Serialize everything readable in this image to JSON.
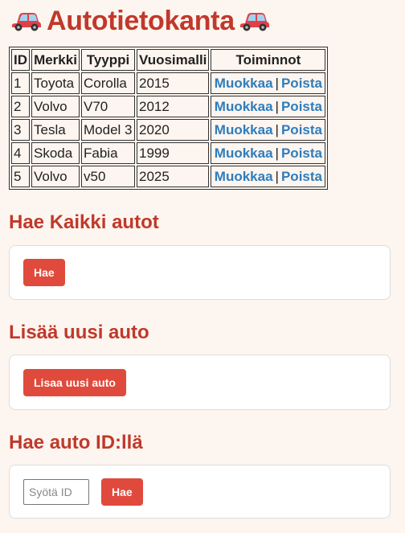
{
  "header": {
    "title": "Autotietokanta",
    "icon": "red-car-icon"
  },
  "table": {
    "columns": [
      "ID",
      "Merkki",
      "Tyyppi",
      "Vuosimalli",
      "Toiminnot"
    ],
    "rows": [
      {
        "id": "1",
        "merkki": "Toyota",
        "tyyppi": "Corolla",
        "vuosimalli": "2015"
      },
      {
        "id": "2",
        "merkki": "Volvo",
        "tyyppi": "V70",
        "vuosimalli": "2012"
      },
      {
        "id": "3",
        "merkki": "Tesla",
        "tyyppi": "Model 3",
        "vuosimalli": "2020"
      },
      {
        "id": "4",
        "merkki": "Skoda",
        "tyyppi": "Fabia",
        "vuosimalli": "1999"
      },
      {
        "id": "5",
        "merkki": "Volvo",
        "tyyppi": "v50",
        "vuosimalli": "2025"
      }
    ],
    "edit_label": "Muokkaa",
    "separator": "|",
    "delete_label": "Poista"
  },
  "sections": {
    "get_all": {
      "title": "Hae Kaikki autot",
      "button": "Hae"
    },
    "add_new": {
      "title": "Lisää uusi auto",
      "button": "Lisaa uusi auto"
    },
    "get_by_id": {
      "title": "Hae auto ID:llä",
      "placeholder": "Syötä ID",
      "value": "",
      "button": "Hae"
    }
  },
  "colors": {
    "accent": "#c0392b",
    "button": "#e04a3c",
    "link": "#2e7dbd",
    "background": "#fdf5ef"
  }
}
